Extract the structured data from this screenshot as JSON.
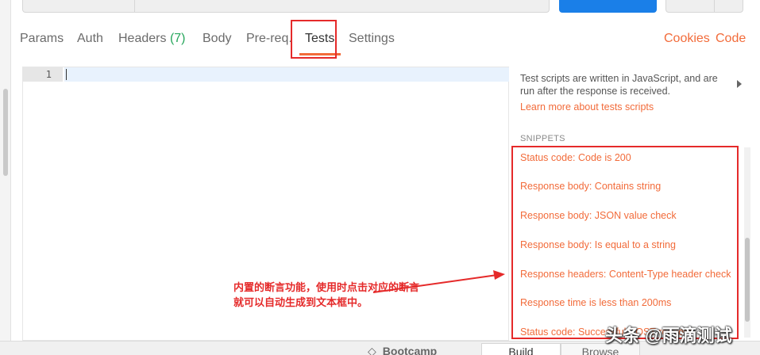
{
  "tabs": {
    "params": "Params",
    "auth": "Auth",
    "headers": "Headers",
    "headers_count": "(7)",
    "body": "Body",
    "prereq": "Pre-req.",
    "tests": "Tests",
    "settings": "Settings",
    "cookies": "Cookies",
    "code": "Code"
  },
  "editor": {
    "line_number": "1"
  },
  "panel": {
    "description": "Test scripts are written in JavaScript, and are run after the response is received.",
    "learn_more": "Learn more about tests scripts",
    "snippets_heading": "SNIPPETS",
    "snippets": [
      "Status code: Code is 200",
      "Response body: Contains string",
      "Response body: JSON value check",
      "Response body: Is equal to a string",
      "Response headers: Content-Type header check",
      "Response time is less than 200ms",
      "Status code: Successful POST request"
    ]
  },
  "annotation": {
    "line1": "内置的断言功能，使用时点击对应的断言",
    "line2": "就可以自动生成到文本框中。"
  },
  "bottom": {
    "bootcamp": "Bootcamp",
    "build": "Build",
    "browse": "Browse"
  },
  "watermark": "头条 @雨滴测试",
  "colors": {
    "accent": "#f26b3a",
    "annotation": "#e52a2a",
    "count": "#26a65b",
    "send": "#1a7fe8"
  }
}
